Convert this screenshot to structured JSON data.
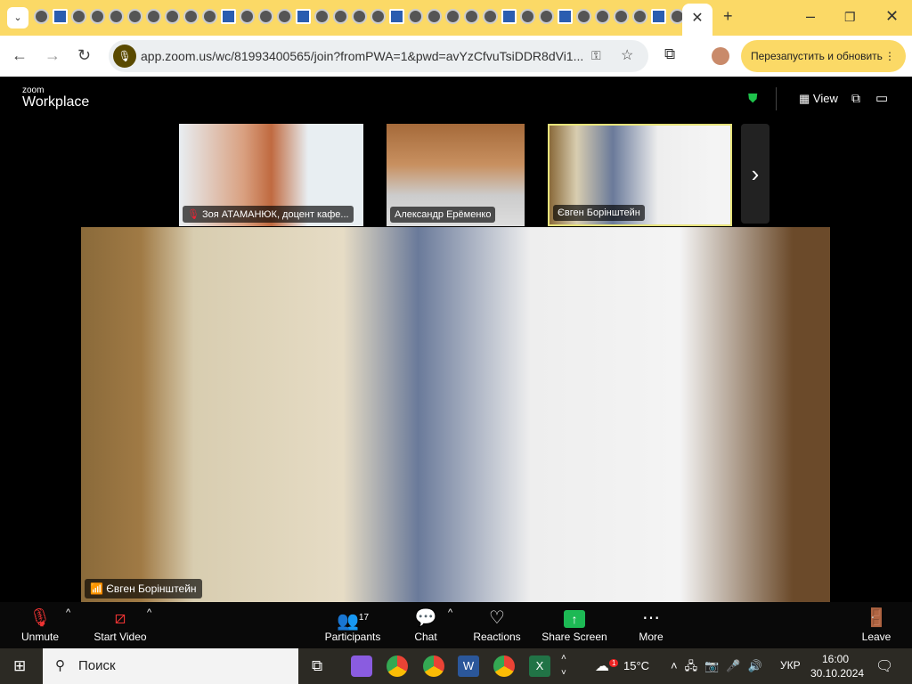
{
  "browser": {
    "tab_favicons": [
      "joomla-icon",
      "u-icon",
      "drive-icon",
      "globe-icon",
      "pkp-icon",
      "globe-icon",
      "globe-icon",
      "globe-icon",
      "globe-icon",
      "globe-icon",
      "flag-icon",
      "badge-icon",
      "globe-icon",
      "globe-icon",
      "pkp-text-icon",
      "wordpress-icon",
      "globe-icon",
      "globe-icon",
      "globe-icon",
      "doc-icon",
      "globe-icon",
      "wiki-icon",
      "globe-icon",
      "globe-icon",
      "globe-icon",
      "doc-icon",
      "globe-icon",
      "globe-icon",
      "translate-icon",
      "globe-icon",
      "globe-icon",
      "globe-icon",
      "globe-icon",
      "translate-icon",
      "heart-icon"
    ],
    "url": "app.zoom.us/wc/81993400565/join?fromPWA=1&pwd=avYzCfvuTsiDDR8dVi1...",
    "relaunch_label": "Перезапустить и обновить"
  },
  "zoom": {
    "logo_top": "zoom",
    "logo_bottom": "Workplace",
    "view_label": "View",
    "thumbnails": [
      {
        "name": "Зоя АТАМАНЮК, доцент кафе...",
        "muted": true
      },
      {
        "name": "Александр Ерёменко",
        "muted": false
      },
      {
        "name": "Євген Борінштейн",
        "muted": false,
        "active": true
      }
    ],
    "main_speaker": "Євген Борінштейн",
    "toolbar": {
      "unmute": "Unmute",
      "start_video": "Start Video",
      "participants": "Participants",
      "participants_count": "17",
      "chat": "Chat",
      "reactions": "Reactions",
      "share": "Share Screen",
      "more": "More",
      "leave": "Leave"
    },
    "share_color": "#1db954"
  },
  "taskbar": {
    "search": "Поиск",
    "weather": "15°C",
    "weather_badge": "1",
    "lang": "УКР",
    "time": "16:00",
    "date": "30.10.2024"
  }
}
